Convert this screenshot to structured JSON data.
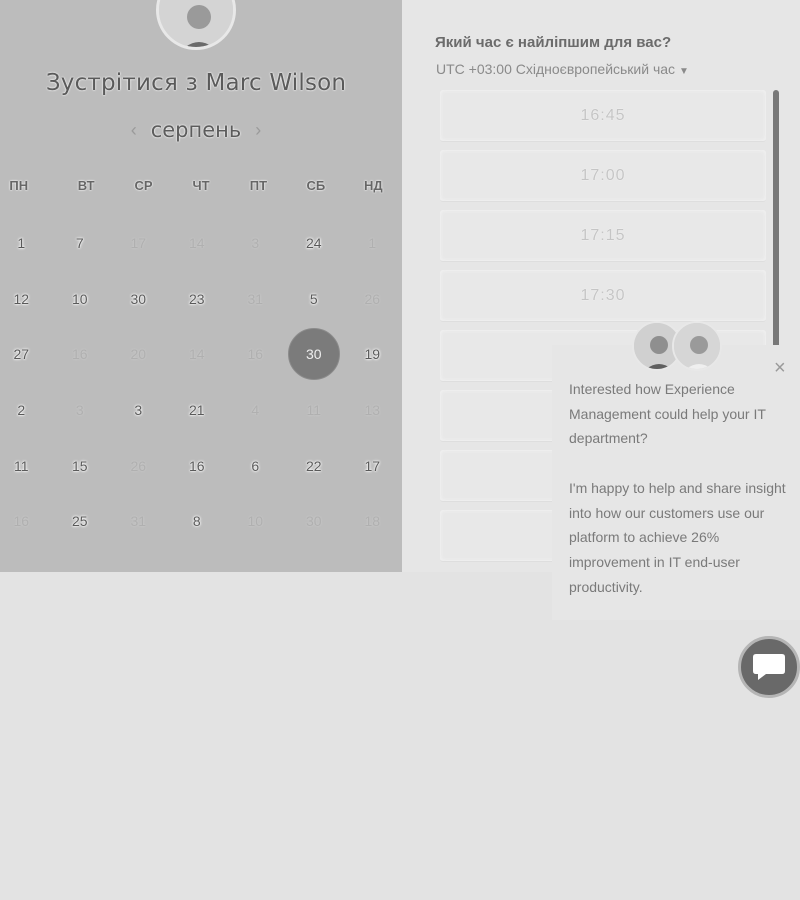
{
  "scheduler": {
    "title": "Зустрітися з Marc Wilson",
    "month": "серпень",
    "prev_icon": "‹",
    "next_icon": "›",
    "weekdays": [
      "ПН",
      "ВТ",
      "СР",
      "ЧТ",
      "ПТ",
      "СБ",
      "НД"
    ],
    "days": [
      {
        "label": "1",
        "muted": false
      },
      {
        "label": "7",
        "muted": false
      },
      {
        "label": "17",
        "muted": true
      },
      {
        "label": "14",
        "muted": true
      },
      {
        "label": "3",
        "muted": true
      },
      {
        "label": "24",
        "muted": false
      },
      {
        "label": "1",
        "muted": true
      },
      {
        "label": "12",
        "muted": false
      },
      {
        "label": "10",
        "muted": false
      },
      {
        "label": "30",
        "muted": false
      },
      {
        "label": "23",
        "muted": false
      },
      {
        "label": "31",
        "muted": true
      },
      {
        "label": "5",
        "muted": false
      },
      {
        "label": "26",
        "muted": true
      },
      {
        "label": "27",
        "muted": false
      },
      {
        "label": "16",
        "muted": true
      },
      {
        "label": "20",
        "muted": true
      },
      {
        "label": "14",
        "muted": true
      },
      {
        "label": "16",
        "muted": true
      },
      {
        "label": "30",
        "muted": false,
        "selected": true
      },
      {
        "label": "19",
        "muted": false
      },
      {
        "label": "2",
        "muted": false
      },
      {
        "label": "3",
        "muted": true
      },
      {
        "label": "3",
        "muted": false
      },
      {
        "label": "21",
        "muted": false
      },
      {
        "label": "4",
        "muted": true
      },
      {
        "label": "11",
        "muted": true
      },
      {
        "label": "13",
        "muted": true
      },
      {
        "label": "11",
        "muted": false
      },
      {
        "label": "15",
        "muted": false
      },
      {
        "label": "26",
        "muted": true
      },
      {
        "label": "16",
        "muted": false
      },
      {
        "label": "6",
        "muted": false
      },
      {
        "label": "22",
        "muted": false
      },
      {
        "label": "17",
        "muted": false
      },
      {
        "label": "16",
        "muted": true
      },
      {
        "label": "25",
        "muted": false
      },
      {
        "label": "31",
        "muted": true
      },
      {
        "label": "8",
        "muted": false
      },
      {
        "label": "10",
        "muted": true
      },
      {
        "label": "30",
        "muted": true
      },
      {
        "label": "18",
        "muted": true
      }
    ]
  },
  "time_picker": {
    "question": "Який час є найліпшим для вас?",
    "timezone": "UTC +03:00 Східноєвропейський час",
    "slots": [
      "16:45",
      "17:00",
      "17:15",
      "17:30",
      "",
      "",
      "",
      ""
    ]
  },
  "chat": {
    "message_1": "Interested how Experience Management could help your IT department?",
    "message_2": "I'm happy to help and share insight into how our customers use our platform to achieve 26% improvement in IT end-user productivity.",
    "close_icon": "×"
  }
}
